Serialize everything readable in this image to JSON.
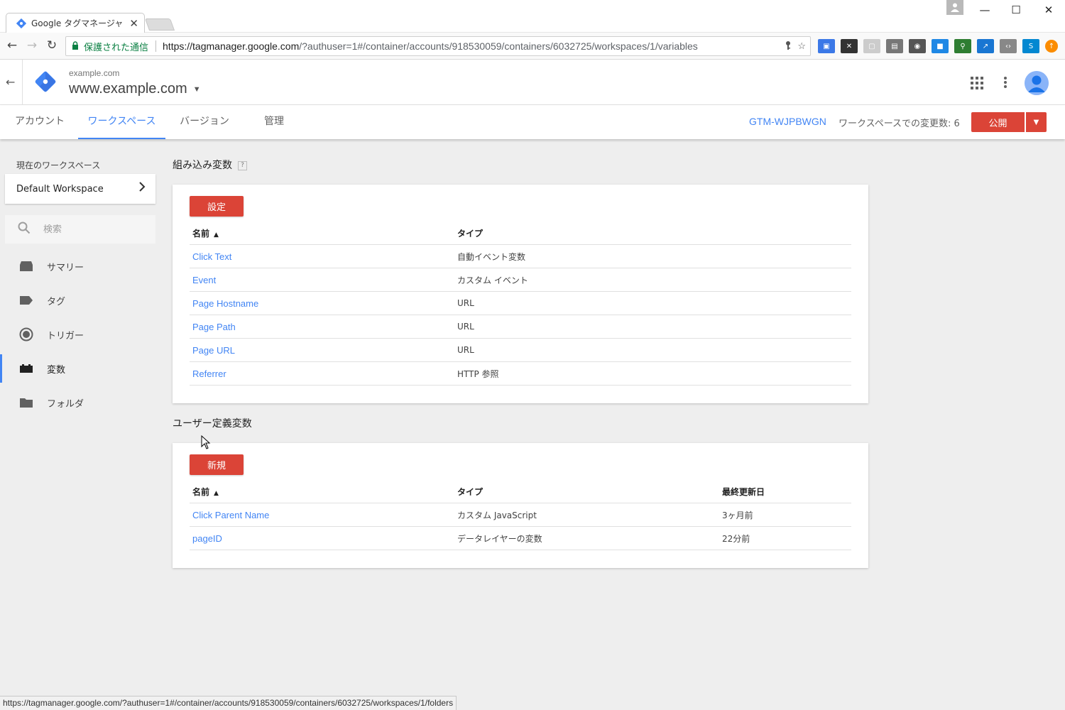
{
  "browser": {
    "tab_title": "Google タグマネージャ",
    "tab_close": "✕",
    "secure_label": "保護された通信",
    "url_host": "https://tagmanager.google.com",
    "url_rest": "/?authuser=1#/container/accounts/918530059/containers/6032725/workspaces/1/variables",
    "status_url": "https://tagmanager.google.com/?authuser=1#/container/accounts/918530059/containers/6032725/workspaces/1/folders",
    "win_minimize": "—",
    "win_maximize": "☐",
    "win_close": "✕"
  },
  "header": {
    "account": "example.com",
    "container": "www.example.com"
  },
  "nav": {
    "tabs": [
      {
        "label": "アカウント"
      },
      {
        "label": "ワークスペース"
      },
      {
        "label": "バージョン"
      },
      {
        "label": "管理"
      }
    ],
    "active_tab": "ワークスペース",
    "container_id": "GTM-WJPBWGN",
    "workspace_changes": "ワークスペースでの変更数: 6",
    "publish_label": "公開"
  },
  "sidebar": {
    "current_ws_label": "現在のワークスペース",
    "workspace_name": "Default Workspace",
    "search_placeholder": "検索",
    "items": [
      {
        "label": "サマリー",
        "icon": "summary-icon"
      },
      {
        "label": "タグ",
        "icon": "tag-icon"
      },
      {
        "label": "トリガー",
        "icon": "trigger-icon"
      },
      {
        "label": "変数",
        "icon": "variable-icon"
      },
      {
        "label": "フォルダ",
        "icon": "folder-icon"
      }
    ],
    "active_item": "変数"
  },
  "builtin": {
    "title": "組み込み変数",
    "help": "?",
    "button": "設定",
    "col_name": "名前",
    "col_type": "タイプ",
    "rows": [
      {
        "name": "Click Text",
        "type": "自動イベント変数"
      },
      {
        "name": "Event",
        "type": "カスタム イベント"
      },
      {
        "name": "Page Hostname",
        "type": "URL"
      },
      {
        "name": "Page Path",
        "type": "URL"
      },
      {
        "name": "Page URL",
        "type": "URL"
      },
      {
        "name": "Referrer",
        "type": "HTTP 参照"
      }
    ]
  },
  "userdefined": {
    "title": "ユーザー定義変数",
    "button": "新規",
    "col_name": "名前",
    "col_type": "タイプ",
    "col_updated": "最終更新日",
    "rows": [
      {
        "name": "Click Parent Name",
        "type": "カスタム JavaScript",
        "updated": "3ヶ月前"
      },
      {
        "name": "pageID",
        "type": "データレイヤーの変数",
        "updated": "22分前"
      }
    ]
  },
  "colors": {
    "accent": "#4285f4",
    "red": "#db4437",
    "secure": "#0b8043"
  }
}
